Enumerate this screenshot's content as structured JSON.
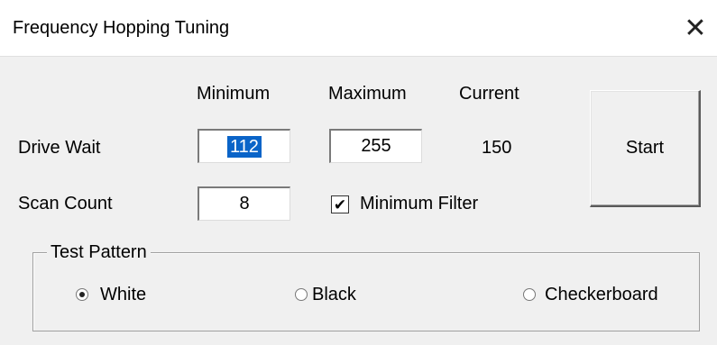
{
  "window": {
    "title": "Frequency Hopping Tuning",
    "close_glyph": "✕"
  },
  "columns": {
    "minimum": "Minimum",
    "maximum": "Maximum",
    "current": "Current"
  },
  "drive_wait": {
    "label": "Drive Wait",
    "minimum": "112",
    "maximum": "255",
    "current": "150"
  },
  "scan_count": {
    "label": "Scan Count",
    "value": "8"
  },
  "minimum_filter": {
    "label": "Minimum Filter",
    "checked": true,
    "check_glyph": "✔"
  },
  "start_button": {
    "label": "Start"
  },
  "test_pattern": {
    "legend": "Test Pattern",
    "options": [
      {
        "label": "White",
        "selected": true
      },
      {
        "label": "Black",
        "selected": false
      },
      {
        "label": "Checkerboard",
        "selected": false
      }
    ]
  },
  "colors": {
    "dialog_bg": "#f0f0f0",
    "selection": "#0a64c8"
  }
}
